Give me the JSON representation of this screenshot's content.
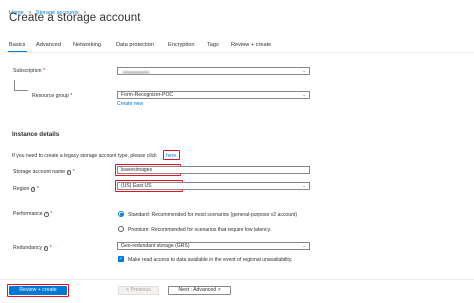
{
  "breadcrumb": {
    "home": "Home",
    "separator": ">",
    "current": "Storage accounts",
    "trailing": ">"
  },
  "page": {
    "title": "Create a storage account",
    "more": "..."
  },
  "tabs": [
    {
      "label": "Basics",
      "active": true
    },
    {
      "label": "Advanced"
    },
    {
      "label": "Networking"
    },
    {
      "label": "Data protection"
    },
    {
      "label": "Encryption"
    },
    {
      "label": "Tags"
    },
    {
      "label": "Review + create"
    }
  ],
  "project": {
    "subscription_label": "Subscription",
    "subscription_value": "",
    "resource_group_label": "Resource group",
    "resource_group_value": "Form-Recognizer-POC",
    "create_new": "Create new"
  },
  "instance": {
    "heading": "Instance details",
    "legacy_note": "If you need to create a legacy storage account type, please click",
    "legacy_link": "here.",
    "name_label": "Storage account name",
    "name_value": "leavesimages",
    "region_label": "Region",
    "region_value": "(US) East US",
    "performance_label": "Performance",
    "perf_standard": "Standard: Recommended for most scenarios (general-purpose v2 account)",
    "perf_premium": "Premium: Recommended for scenarios that require low latency.",
    "redundancy_label": "Redundancy",
    "redundancy_value": "Geo-redundant storage (GRS)",
    "read_access": "Make read access to data available in the event of regional unavailability."
  },
  "footer": {
    "review_create": "Review + create",
    "previous": "< Previous",
    "next": "Next : Advanced >"
  },
  "colors": {
    "accent": "#0078d4",
    "highlight": "#e81123"
  }
}
